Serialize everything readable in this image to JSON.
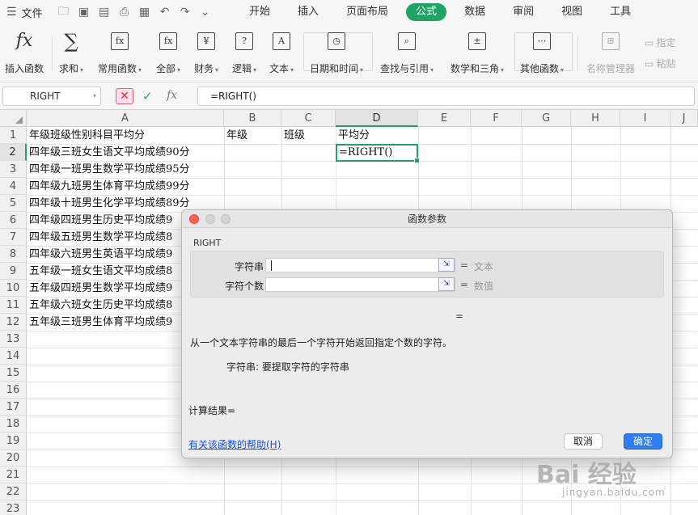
{
  "menubar": {
    "file_label": "文件",
    "tabs": [
      {
        "label": "开始",
        "active": false
      },
      {
        "label": "插入",
        "active": false
      },
      {
        "label": "页面布局",
        "active": false
      },
      {
        "label": "公式",
        "active": true
      },
      {
        "label": "数据",
        "active": false
      },
      {
        "label": "审阅",
        "active": false
      },
      {
        "label": "视图",
        "active": false
      },
      {
        "label": "工具",
        "active": false
      }
    ]
  },
  "ribbon": {
    "insert_function": "插入函数",
    "sum": "求和",
    "common": "常用函数",
    "all": "全部",
    "finance": "财务",
    "logic": "逻辑",
    "text": "文本",
    "datetime": "日期和时间",
    "lookup": "查找与引用",
    "math": "数学和三角",
    "other": "其他函数",
    "name_manager": "名称管理器",
    "assign": "指定",
    "paste": "粘贴"
  },
  "formula_bar": {
    "name_box": "RIGHT",
    "formula": "=RIGHT()"
  },
  "grid": {
    "columns": [
      "A",
      "B",
      "C",
      "D",
      "E",
      "F",
      "G",
      "H",
      "I",
      "J"
    ],
    "rows": [
      "1",
      "2",
      "3",
      "4",
      "5",
      "6",
      "7",
      "8",
      "9",
      "10",
      "11",
      "12",
      "13",
      "14",
      "15",
      "16",
      "17",
      "18",
      "19",
      "20",
      "21",
      "22",
      "23"
    ],
    "header_row": {
      "A": "年级班级性别科目平均分",
      "B": "年级",
      "C": "班级",
      "D": "平均分"
    },
    "d2": "=RIGHT()",
    "col_a": [
      "四年级三班女生语文平均成绩90分",
      "四年级一班男生数学平均成绩95分",
      "四年级九班男生体育平均成绩99分",
      "四年级十班男生化学平均成绩89分",
      "四年级四班男生历史平均成绩9",
      "四年级五班男生数学平均成绩8",
      "四年级六班男生英语平均成绩9",
      "五年级一班女生语文平均成绩8",
      "五年级四班男生数学平均成绩9",
      "五年级六班女生历史平均成绩8",
      "五年级三班男生体育平均成绩9"
    ]
  },
  "dialog": {
    "title": "函数参数",
    "function_name": "RIGHT",
    "args": [
      {
        "label": "字符串",
        "value": "",
        "hint": "文本"
      },
      {
        "label": "字符个数",
        "value": "",
        "hint": "数值"
      }
    ],
    "eq_sign": "=",
    "eq_result": "=",
    "description": "从一个文本字符串的最后一个字符开始返回指定个数的字符。",
    "arg_description": "字符串: 要提取字符的字符串",
    "result_label": "计算结果=",
    "help_link": "有关该函数的帮助(H)",
    "cancel": "取消",
    "ok": "确定"
  },
  "watermark": {
    "logo": "Bai 经验",
    "url": "jingyan.baidu.com"
  },
  "colors": {
    "accent": "#21a366",
    "ok_button": "#2f7ef0",
    "link": "#1a4fd6"
  }
}
